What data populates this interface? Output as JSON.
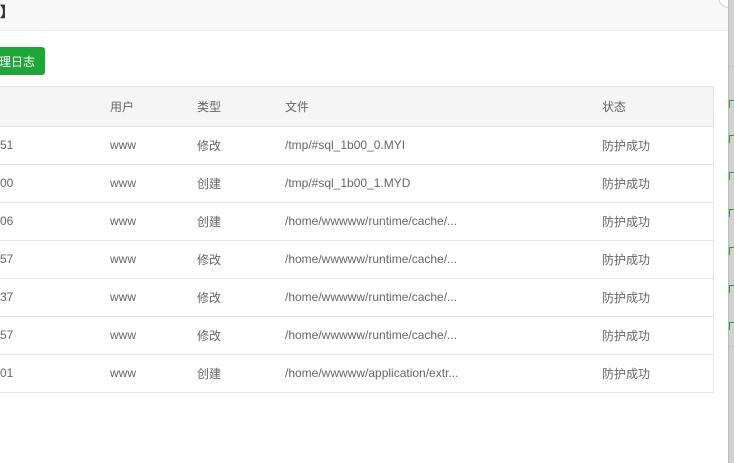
{
  "dialog": {
    "title_fragment": "】"
  },
  "toolbar": {
    "log_button_label": "理日志"
  },
  "table": {
    "headers": [
      "",
      "用户",
      "类型",
      "文件",
      "状态"
    ],
    "rows": [
      {
        "time": "51",
        "user": "www",
        "type": "修改",
        "file": "/tmp/#sql_1b00_0.MYI",
        "status": "防护成功"
      },
      {
        "time": "00",
        "user": "www",
        "type": "创建",
        "file": "/tmp/#sql_1b00_1.MYD",
        "status": "防护成功"
      },
      {
        "time": "06",
        "user": "www",
        "type": "创建",
        "file": "/home/wwwww/runtime/cache/...",
        "status": "防护成功"
      },
      {
        "time": "57",
        "user": "www",
        "type": "修改",
        "file": "/home/wwwww/runtime/cache/...",
        "status": "防护成功"
      },
      {
        "time": "37",
        "user": "www",
        "type": "修改",
        "file": "/home/wwwww/runtime/cache/...",
        "status": "防护成功"
      },
      {
        "time": "57",
        "user": "www",
        "type": "修改",
        "file": "/home/wwwww/runtime/cache/...",
        "status": "防护成功"
      },
      {
        "time": "01",
        "user": "www",
        "type": "创建",
        "file": "/home/wwwww/application/extr...",
        "status": "防护成功"
      }
    ]
  },
  "colors": {
    "accent": "#20a53a",
    "header_bg": "#f5f5f5",
    "border": "#e5e5e5"
  }
}
